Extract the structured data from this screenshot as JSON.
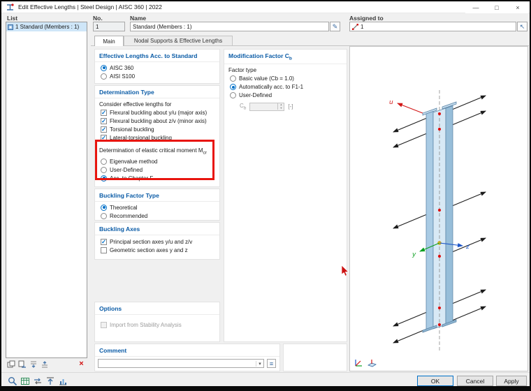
{
  "window": {
    "title": "Edit Effective Lengths | Steel Design | AISC 360 | 2022"
  },
  "titlebar_icons": {
    "minimize": "—",
    "maximize": "□",
    "close": "×"
  },
  "glyphs": {
    "check": "✓",
    "dropdown": "▾",
    "spin_up": "▴",
    "spin_down": "▾",
    "edit": "✎",
    "pick": "↖",
    "red_x": "×",
    "menu": "≡"
  },
  "list_panel": {
    "label": "List",
    "items": [
      {
        "label": "1 Standard (Members : 1)"
      }
    ]
  },
  "header": {
    "no_label": "No.",
    "no_value": "1",
    "name_label": "Name",
    "name_value": "Standard (Members : 1)",
    "assigned_label": "Assigned to",
    "assigned_value": "1"
  },
  "tabs": [
    {
      "label": "Main"
    },
    {
      "label": "Nodal Supports & Effective Lengths"
    }
  ],
  "standard_section": {
    "title": "Effective Lengths Acc. to Standard",
    "options": [
      {
        "label": "AISC 360",
        "selected": true
      },
      {
        "label": "AISI S100",
        "selected": false
      }
    ]
  },
  "determination_section": {
    "title": "Determination Type",
    "subtitle": "Consider effective lengths for",
    "checks": [
      {
        "label": "Flexural buckling about y/u (major axis)",
        "checked": true
      },
      {
        "label": "Flexural buckling about z/v (minor axis)",
        "checked": true
      },
      {
        "label": "Torsional buckling",
        "checked": true
      },
      {
        "label": "Lateral-torsional buckling",
        "checked": true
      }
    ],
    "mcr": {
      "title_main": "Determination of elastic critical moment M",
      "title_sub": "cr",
      "options": [
        {
          "label": "Eigenvalue method",
          "selected": false
        },
        {
          "label": "User-Defined",
          "selected": false
        },
        {
          "label": "Acc. to Chapter F",
          "selected": true
        }
      ]
    }
  },
  "buckling_factor_section": {
    "title": "Buckling Factor Type",
    "options": [
      {
        "label": "Theoretical",
        "selected": true
      },
      {
        "label": "Recommended",
        "selected": false
      }
    ]
  },
  "buckling_axes_section": {
    "title": "Buckling Axes",
    "checks": [
      {
        "label": "Principal section axes y/u and z/v",
        "checked": true
      },
      {
        "label": "Geometric section axes y and z",
        "checked": false
      }
    ]
  },
  "options_section": {
    "title": "Options",
    "checks": [
      {
        "label": "Import from Stability Analysis",
        "checked": false,
        "disabled": true
      }
    ]
  },
  "comment_section": {
    "title": "Comment",
    "value": ""
  },
  "cb_section": {
    "title_main": "Modification Factor C",
    "title_sub": "b",
    "factor_type_label": "Factor type",
    "options": [
      {
        "label": "Basic value (Cb = 1.0)",
        "selected": false
      },
      {
        "label": "Automatically acc. to F1-1",
        "selected": true
      },
      {
        "label": "User-Defined",
        "selected": false
      }
    ],
    "cb_label_main": "C",
    "cb_label_sub": "b",
    "cb_value": "",
    "unit": "[-]"
  },
  "viewport": {
    "axis_u": "u",
    "axis_y": "y",
    "axis_z": "z"
  },
  "footer": {
    "ok": "OK",
    "cancel": "Cancel",
    "apply": "Apply"
  }
}
